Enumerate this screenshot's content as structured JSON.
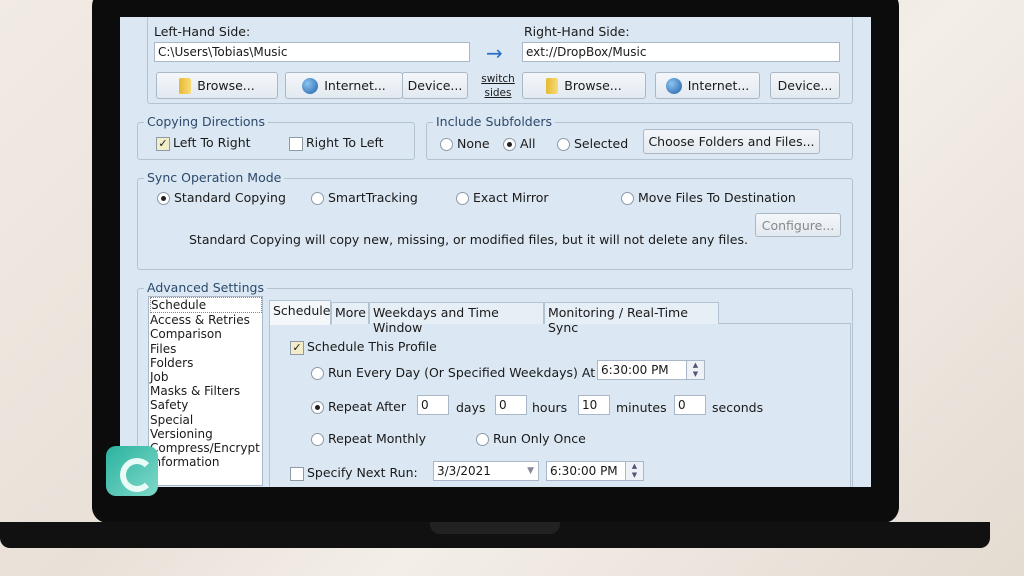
{
  "left": {
    "label": "Left-Hand Side:",
    "path": "C:\\Users\\Tobias\\Music",
    "browse": "Browse...",
    "internet": "Internet...",
    "device": "Device..."
  },
  "right": {
    "label": "Right-Hand Side:",
    "path": "ext://DropBox/Music",
    "browse": "Browse...",
    "internet": "Internet...",
    "device": "Device..."
  },
  "switch_sides": [
    "switch",
    "sides"
  ],
  "copying": {
    "title": "Copying Directions",
    "ltr": "Left To Right",
    "rtl": "Right To Left",
    "ltr_checked": true,
    "rtl_checked": false
  },
  "subfolders": {
    "title": "Include Subfolders",
    "none": "None",
    "all": "All",
    "selected": "Selected",
    "choose": "Choose Folders and Files...",
    "value": "All"
  },
  "mode": {
    "title": "Sync Operation Mode",
    "options": [
      "Standard Copying",
      "SmartTracking",
      "Exact Mirror",
      "Move Files To Destination"
    ],
    "value": "Standard Copying",
    "configure": "Configure...",
    "description": "Standard Copying will copy new, missing, or modified files, but it will not delete any files."
  },
  "advanced": {
    "title": "Advanced Settings",
    "items": [
      "Schedule",
      "Access & Retries",
      "Comparison",
      "Files",
      "Folders",
      "Job",
      "Masks & Filters",
      "Safety",
      "Special",
      "Versioning",
      "Compress/Encrypt",
      "Information"
    ],
    "selected": "Schedule"
  },
  "tabs": [
    "Schedule",
    "More",
    "Weekdays and Time Window",
    "Monitoring / Real-Time Sync"
  ],
  "schedule": {
    "enable": "Schedule This Profile",
    "enabled": true,
    "every_day": "Run Every Day (Or Specified Weekdays) At",
    "every_day_time": "6:30:00 PM",
    "repeat_after": "Repeat After",
    "days": "0",
    "days_label": "days",
    "hours": "0",
    "hours_label": "hours",
    "minutes": "10",
    "minutes_label": "minutes",
    "seconds": "0",
    "seconds_label": "seconds",
    "monthly": "Repeat Monthly",
    "once": "Run Only Once",
    "next_run": "Specify Next Run:",
    "next_date": "3/3/2021",
    "next_time": "6:30:00 PM",
    "mode": "Repeat After"
  },
  "colors": {
    "accent": "#2b6fc4",
    "window_bg": "#dbe7f2",
    "legend_text": "#2b4a6c"
  }
}
